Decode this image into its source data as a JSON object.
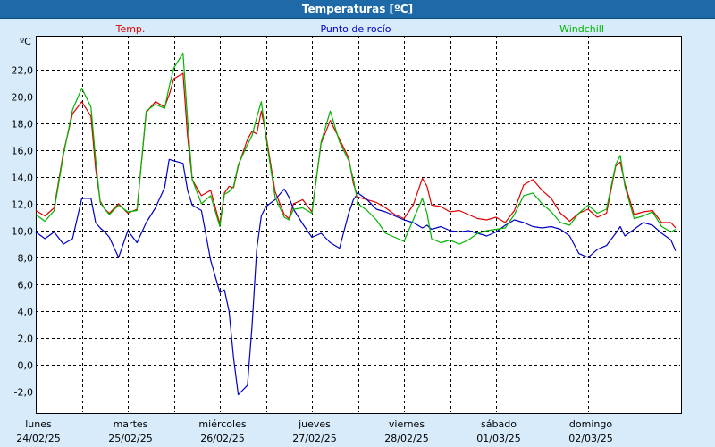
{
  "window": {
    "title": "Temperaturas [ºC]"
  },
  "chart_data": {
    "type": "line",
    "title": "Temperaturas [ºC]",
    "unit_label": "ºC",
    "ylim": [
      -3.5,
      24.5
    ],
    "yticks": [
      -2,
      0,
      2,
      4,
      6,
      8,
      10,
      12,
      14,
      16,
      18,
      20,
      22
    ],
    "ytick_labels": [
      "-2,0",
      "0,0",
      "2,0",
      "4,0",
      "6,0",
      "8,0",
      "10,0",
      "12,0",
      "14,0",
      "16,0",
      "18,0",
      "20,0",
      "22,0"
    ],
    "x_range_days": [
      0,
      7
    ],
    "days": [
      {
        "day": "lunes",
        "date": "24/02/25"
      },
      {
        "day": "martes",
        "date": "25/02/25"
      },
      {
        "day": "miércoles",
        "date": "26/02/25"
      },
      {
        "day": "jueves",
        "date": "27/02/25"
      },
      {
        "day": "viernes",
        "date": "28/02/25"
      },
      {
        "day": "sábado",
        "date": "01/03/25"
      },
      {
        "day": "domingo",
        "date": "02/03/25"
      }
    ],
    "grid": true,
    "legend_position": "top",
    "x": [
      0.0,
      0.1,
      0.2,
      0.3,
      0.4,
      0.5,
      0.6,
      0.65,
      0.7,
      0.75,
      0.8,
      0.9,
      1.0,
      1.1,
      1.2,
      1.3,
      1.4,
      1.45,
      1.5,
      1.6,
      1.65,
      1.7,
      1.8,
      1.9,
      2.0,
      2.05,
      2.1,
      2.15,
      2.2,
      2.3,
      2.35,
      2.4,
      2.45,
      2.5,
      2.6,
      2.7,
      2.75,
      2.8,
      2.9,
      3.0,
      3.1,
      3.2,
      3.3,
      3.4,
      3.45,
      3.5,
      3.6,
      3.7,
      3.8,
      3.9,
      4.0,
      4.1,
      4.2,
      4.25,
      4.3,
      4.4,
      4.5,
      4.6,
      4.7,
      4.8,
      4.9,
      5.0,
      5.1,
      5.2,
      5.3,
      5.4,
      5.5,
      5.6,
      5.7,
      5.8,
      5.9,
      6.0,
      6.1,
      6.2,
      6.3,
      6.35,
      6.4,
      6.5,
      6.6,
      6.7,
      6.8,
      6.9,
      6.95
    ],
    "series": [
      {
        "name": "Temp.",
        "color": "#e00000",
        "values": [
          11.5,
          11.1,
          11.7,
          15.8,
          18.7,
          19.6,
          18.5,
          14.6,
          12.2,
          11.6,
          11.3,
          12.0,
          11.3,
          11.6,
          18.8,
          19.6,
          19.2,
          20.1,
          21.3,
          21.7,
          17.0,
          13.8,
          12.6,
          13.0,
          10.5,
          12.8,
          13.3,
          13.2,
          14.8,
          16.8,
          17.4,
          17.2,
          18.9,
          17.2,
          12.9,
          11.2,
          10.9,
          12.0,
          12.3,
          11.4,
          16.5,
          18.2,
          16.8,
          15.4,
          13.5,
          12.5,
          12.3,
          12.1,
          11.7,
          11.2,
          10.9,
          11.9,
          13.9,
          13.3,
          11.9,
          11.8,
          11.4,
          11.5,
          11.2,
          10.9,
          10.8,
          11.0,
          10.6,
          11.5,
          13.4,
          13.8,
          13.0,
          12.4,
          11.3,
          10.7,
          11.3,
          11.6,
          11.0,
          11.3,
          14.8,
          15.1,
          13.5,
          11.2,
          11.4,
          11.5,
          10.6,
          10.6,
          10.2
        ]
      },
      {
        "name": "Punto de rocío",
        "color": "#0000c8",
        "values": [
          9.9,
          9.4,
          9.9,
          9.0,
          9.4,
          12.4,
          12.4,
          10.6,
          10.2,
          9.9,
          9.5,
          8.0,
          10.0,
          9.1,
          10.6,
          11.7,
          13.2,
          15.3,
          15.2,
          15.0,
          13.0,
          11.9,
          11.5,
          7.8,
          5.4,
          5.6,
          4.0,
          0.5,
          -2.2,
          -1.5,
          3.0,
          8.6,
          11.1,
          11.8,
          12.3,
          13.1,
          12.5,
          11.6,
          10.5,
          9.5,
          9.8,
          9.1,
          8.7,
          11.3,
          12.3,
          12.8,
          12.3,
          11.6,
          11.4,
          11.1,
          10.8,
          10.6,
          10.2,
          10.4,
          10.1,
          10.3,
          10.0,
          9.9,
          10.0,
          9.8,
          9.6,
          9.9,
          10.4,
          10.8,
          10.6,
          10.3,
          10.2,
          10.3,
          10.1,
          9.6,
          8.3,
          8.0,
          8.6,
          8.9,
          9.8,
          10.3,
          9.6,
          10.1,
          10.6,
          10.4,
          9.8,
          9.3,
          8.5
        ]
      },
      {
        "name": "Windchill",
        "color": "#00b400",
        "values": [
          11.2,
          10.7,
          11.5,
          15.6,
          19.0,
          20.6,
          19.2,
          15.3,
          12.1,
          11.6,
          11.2,
          11.9,
          11.4,
          11.5,
          18.9,
          19.4,
          19.1,
          20.7,
          22.1,
          23.2,
          18.2,
          13.8,
          12.0,
          12.6,
          10.3,
          12.7,
          12.9,
          13.3,
          14.9,
          16.4,
          17.1,
          18.4,
          19.6,
          17.0,
          12.5,
          11.0,
          10.8,
          11.6,
          11.7,
          11.3,
          16.6,
          18.9,
          16.6,
          15.2,
          13.8,
          12.0,
          11.5,
          10.8,
          9.8,
          9.5,
          9.2,
          10.8,
          12.4,
          11.3,
          9.4,
          9.1,
          9.3,
          9.0,
          9.3,
          9.8,
          10.0,
          10.1,
          10.2,
          11.2,
          12.6,
          12.8,
          12.0,
          11.4,
          10.6,
          10.4,
          11.3,
          11.9,
          11.3,
          11.6,
          14.9,
          15.6,
          13.3,
          10.9,
          11.1,
          11.4,
          10.3,
          9.9,
          10.1
        ]
      }
    ]
  }
}
